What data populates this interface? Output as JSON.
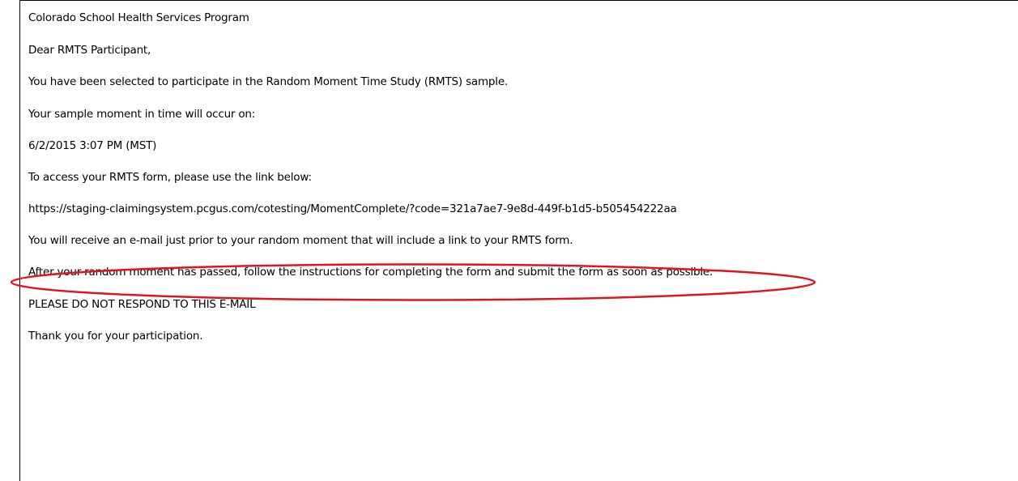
{
  "email": {
    "program_name": "Colorado School Health Services Program",
    "greeting": "Dear RMTS Participant,",
    "selected_text": "You have been selected to participate in the Random Moment Time Study (RMTS) sample.",
    "moment_intro": "Your sample moment in time will occur on:",
    "moment_datetime": "6/2/2015 3:07 PM (MST)",
    "access_intro": "To access your RMTS form, please use the link below:",
    "form_link": "https://staging-claimingsystem.pcgus.com/cotesting/MomentComplete/?code=321a7ae7-9e8d-449f-b1d5-b505454222aa",
    "reminder_text": "You will receive an e-mail just prior to your random moment that will include a link to your RMTS form.",
    "instructions_text": "After your random moment has passed, follow the instructions for completing the form and submit the form as soon as possible.",
    "no_reply_notice": "PLEASE DO NOT RESPOND TO THIS E-MAIL",
    "closing": "Thank you for your participation."
  },
  "annotation": {
    "highlight_color": "#e0141e"
  }
}
